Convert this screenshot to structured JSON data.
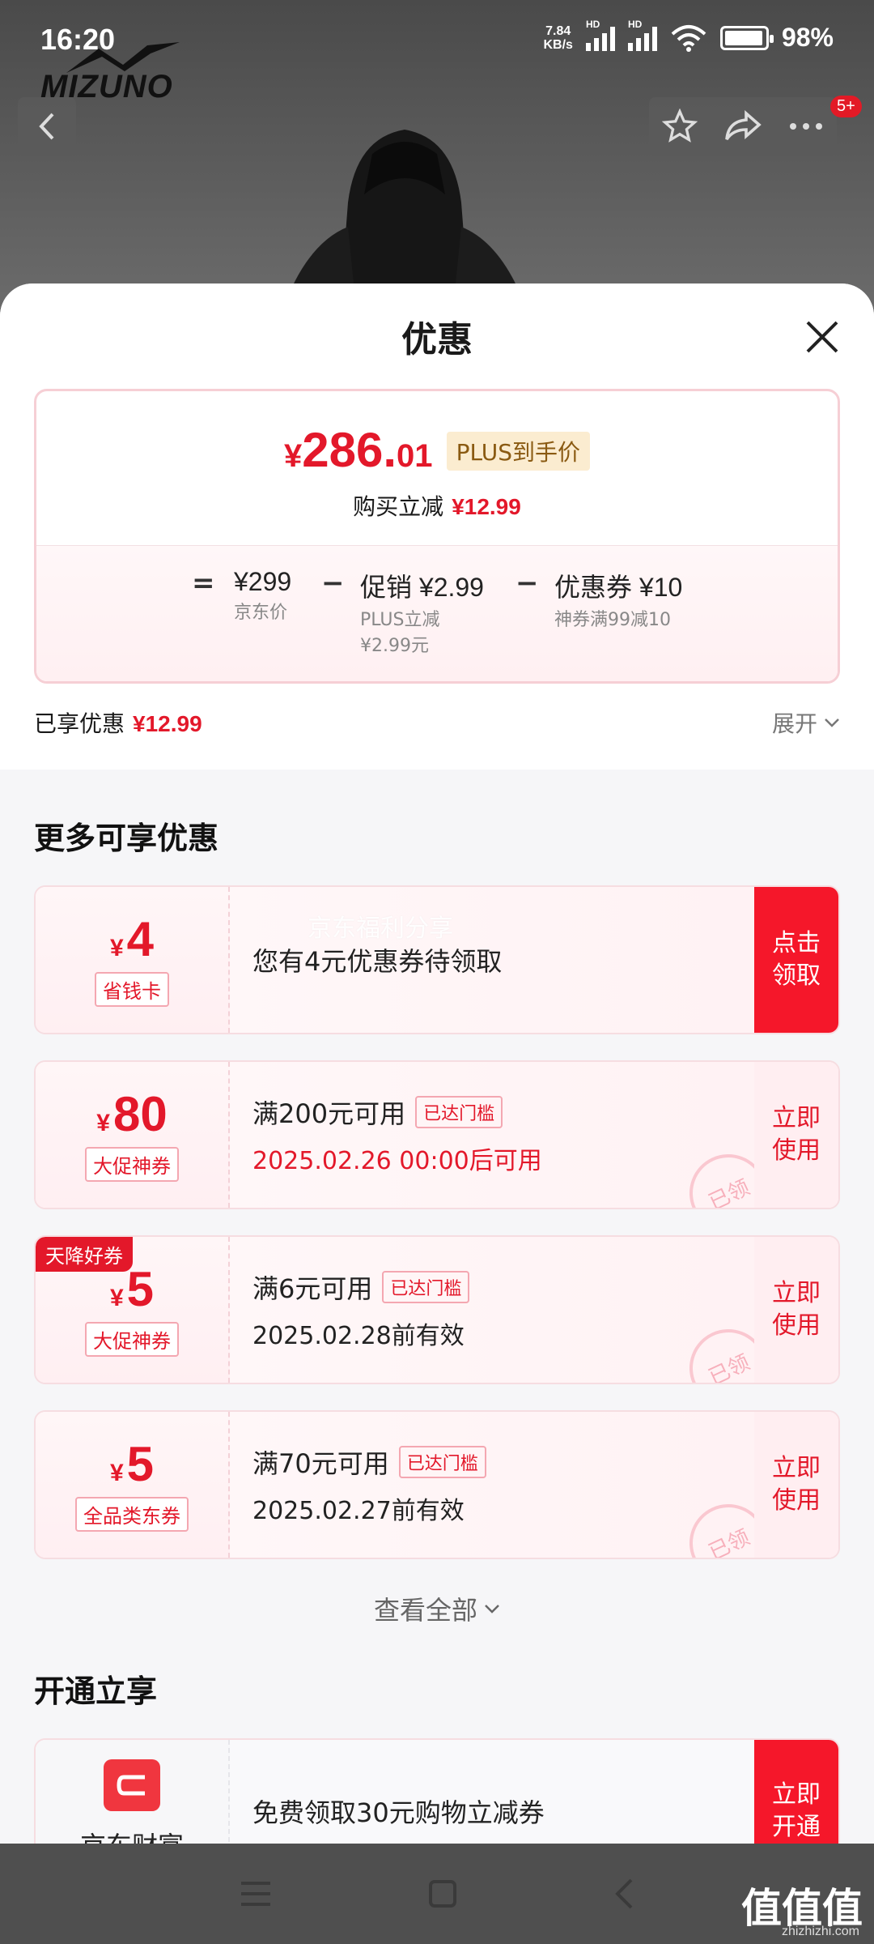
{
  "status_bar": {
    "time": "16:20",
    "net_speed_value": "7.84",
    "net_speed_unit": "KB/s",
    "battery": "98%",
    "battery_level": 0.98,
    "hd1": "HD",
    "hd2": "HD",
    "wifi_sub": "6"
  },
  "product_header": {
    "brand": "MIZUNO",
    "badge_count": "5+",
    "icons": [
      "back-icon",
      "star-icon",
      "share-icon",
      "more-icon"
    ]
  },
  "sheet": {
    "title": "优惠",
    "price": {
      "currency": "¥",
      "integer": "286.",
      "decimal": "01",
      "plus_tag": "PLUS到手价",
      "instant_label": "购买立减",
      "instant_value": "¥12.99"
    },
    "formula": {
      "eq": "=",
      "op1": "−",
      "op2": "−",
      "items": [
        {
          "main": "¥299",
          "sub": "京东价"
        },
        {
          "main": "促销 ¥2.99",
          "sub": "PLUS立减\n¥2.99元"
        },
        {
          "main": "优惠券 ¥10",
          "sub": "神券满99减10"
        }
      ]
    },
    "enjoyed": {
      "label": "已享优惠",
      "value": "¥12.99",
      "expand": "展开"
    }
  },
  "more_offers": {
    "title": "更多可享优惠",
    "coupons": [
      {
        "currency": "¥",
        "amount": "4",
        "type": "省钱卡",
        "line1": "您有4元优惠券待领取",
        "line2": "",
        "reached": "",
        "action": "点击\n领取",
        "stamp": "",
        "corner": "",
        "watermark": "京东福利分享"
      },
      {
        "currency": "¥",
        "amount": "80",
        "type": "大促神券",
        "line1": "满200元可用",
        "line2": "2025.02.26 00:00后可用",
        "reached": "已达门槛",
        "action": "立即\n使用",
        "stamp": "已领",
        "corner": ""
      },
      {
        "currency": "¥",
        "amount": "5",
        "type": "大促神券",
        "line1": "满6元可用",
        "line2": "2025.02.28前有效",
        "reached": "已达门槛",
        "action": "立即\n使用",
        "stamp": "已领",
        "corner": "天降好券"
      },
      {
        "currency": "¥",
        "amount": "5",
        "type": "全品类东券",
        "line1": "满70元可用",
        "line2": "2025.02.27前有效",
        "reached": "已达门槛",
        "action": "立即\n使用",
        "stamp": "已领",
        "corner": ""
      }
    ],
    "view_all": "查看全部"
  },
  "open_enjoy": {
    "title": "开通立享",
    "item": {
      "name": "京东财富",
      "text": "免费领取30元购物立减券",
      "action": "立即\n开通"
    }
  },
  "watermark_site": {
    "name": "值值值",
    "domain": "zhizhizhi.com"
  },
  "colors": {
    "accent_red": "#e3182a",
    "plus_gold": "#fbecd0"
  }
}
